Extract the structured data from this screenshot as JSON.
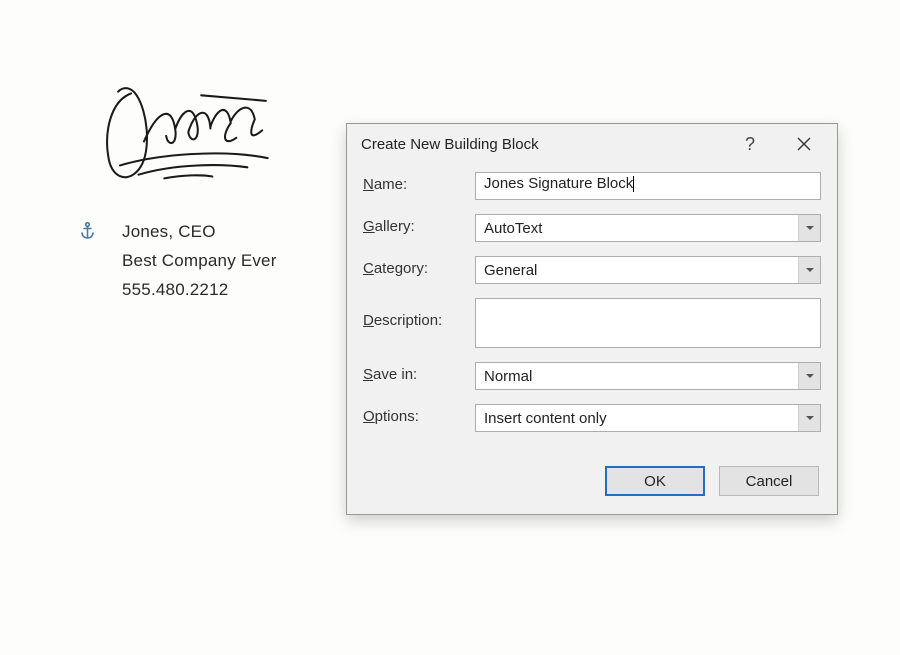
{
  "signature_block": {
    "line1": "Jones, CEO",
    "line2": "Best Company Ever",
    "line3": "555.480.2212"
  },
  "dialog": {
    "title": "Create New Building Block",
    "fields": {
      "name": {
        "label_pre": "N",
        "label_rest": "ame:",
        "value": "Jones Signature Block"
      },
      "gallery": {
        "label_pre": "G",
        "label_rest": "allery:",
        "value": "AutoText"
      },
      "category": {
        "label_pre": "C",
        "label_rest": "ategory:",
        "value": "General"
      },
      "description": {
        "label_pre": "D",
        "label_rest": "escription:",
        "value": ""
      },
      "save_in": {
        "label_pre": "S",
        "label_rest": "ave in:",
        "value": "Normal"
      },
      "options": {
        "label_pre": "O",
        "label_rest": "ptions:",
        "value": "Insert content only"
      }
    },
    "buttons": {
      "ok": "OK",
      "cancel": "Cancel"
    }
  }
}
